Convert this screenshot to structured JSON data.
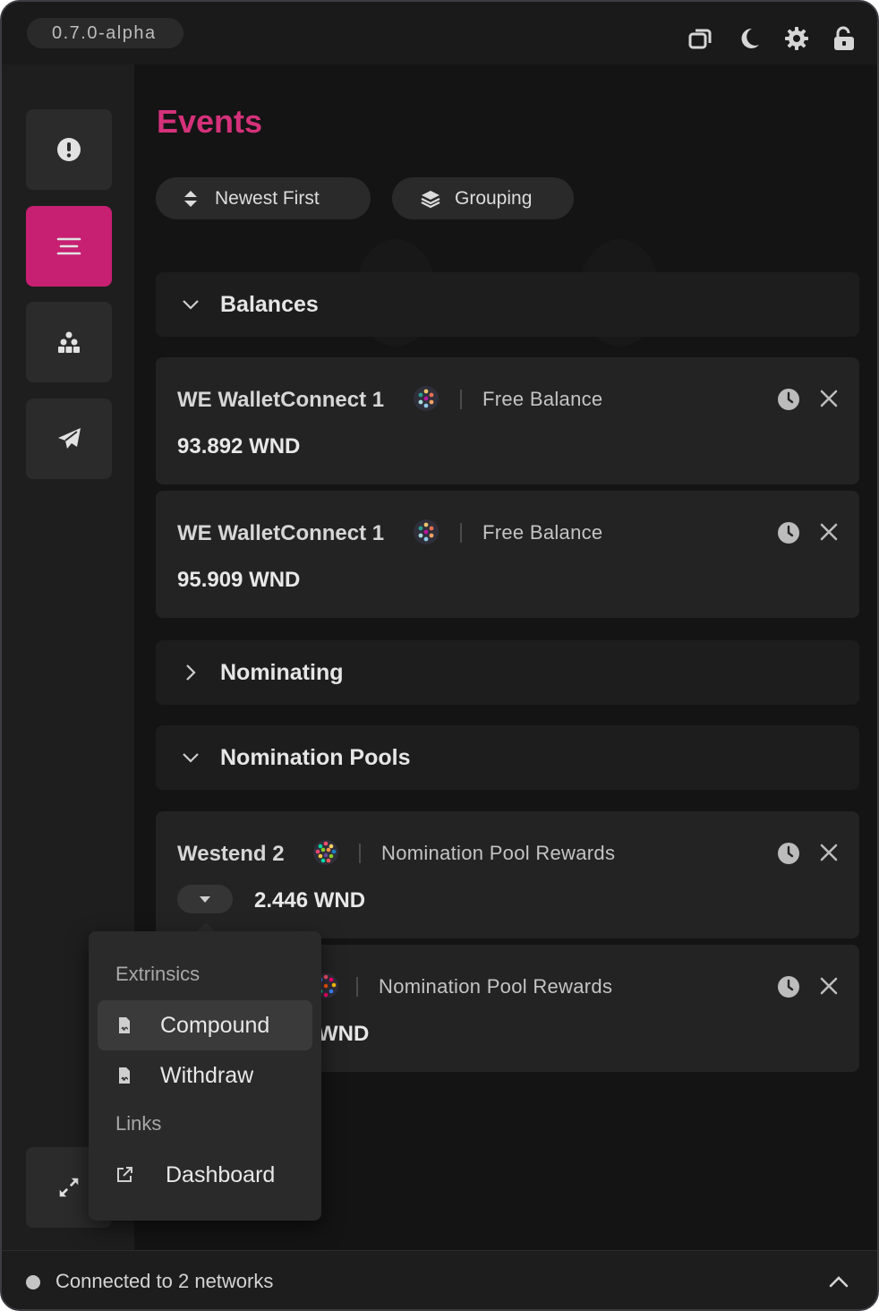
{
  "app": {
    "version": "0.7.0-alpha",
    "accent": "#c71f72"
  },
  "topbar": {
    "icons": [
      "windows-icon",
      "moon-icon",
      "gear-icon",
      "unlock-icon"
    ]
  },
  "sidebar": {
    "items": [
      "overview-icon",
      "events-icon",
      "accounts-icon",
      "send-icon"
    ],
    "active": "events-icon",
    "expand_icon": "expand-icon"
  },
  "page": {
    "title": "Events",
    "sort_label": "Newest First",
    "grouping_label": "Grouping"
  },
  "categories": {
    "balances": "Balances",
    "nominating": "Nominating",
    "nomination_pools": "Nomination Pools"
  },
  "events": [
    {
      "account": "WE WalletConnect 1",
      "type": "Free Balance",
      "value": "93.892 WND"
    },
    {
      "account": "WE WalletConnect 1",
      "type": "Free Balance",
      "value": "95.909 WND"
    },
    {
      "account": "Westend 2",
      "type": "Nomination Pool Rewards",
      "value": "2.446 WND"
    },
    {
      "account": "",
      "type": "Nomination Pool Rewards",
      "value": "WND"
    }
  ],
  "dropdown": {
    "extrinsics_header": "Extrinsics",
    "compound": "Compound",
    "withdraw": "Withdraw",
    "links_header": "Links",
    "dashboard": "Dashboard"
  },
  "status": {
    "text": "Connected to 2 networks"
  }
}
